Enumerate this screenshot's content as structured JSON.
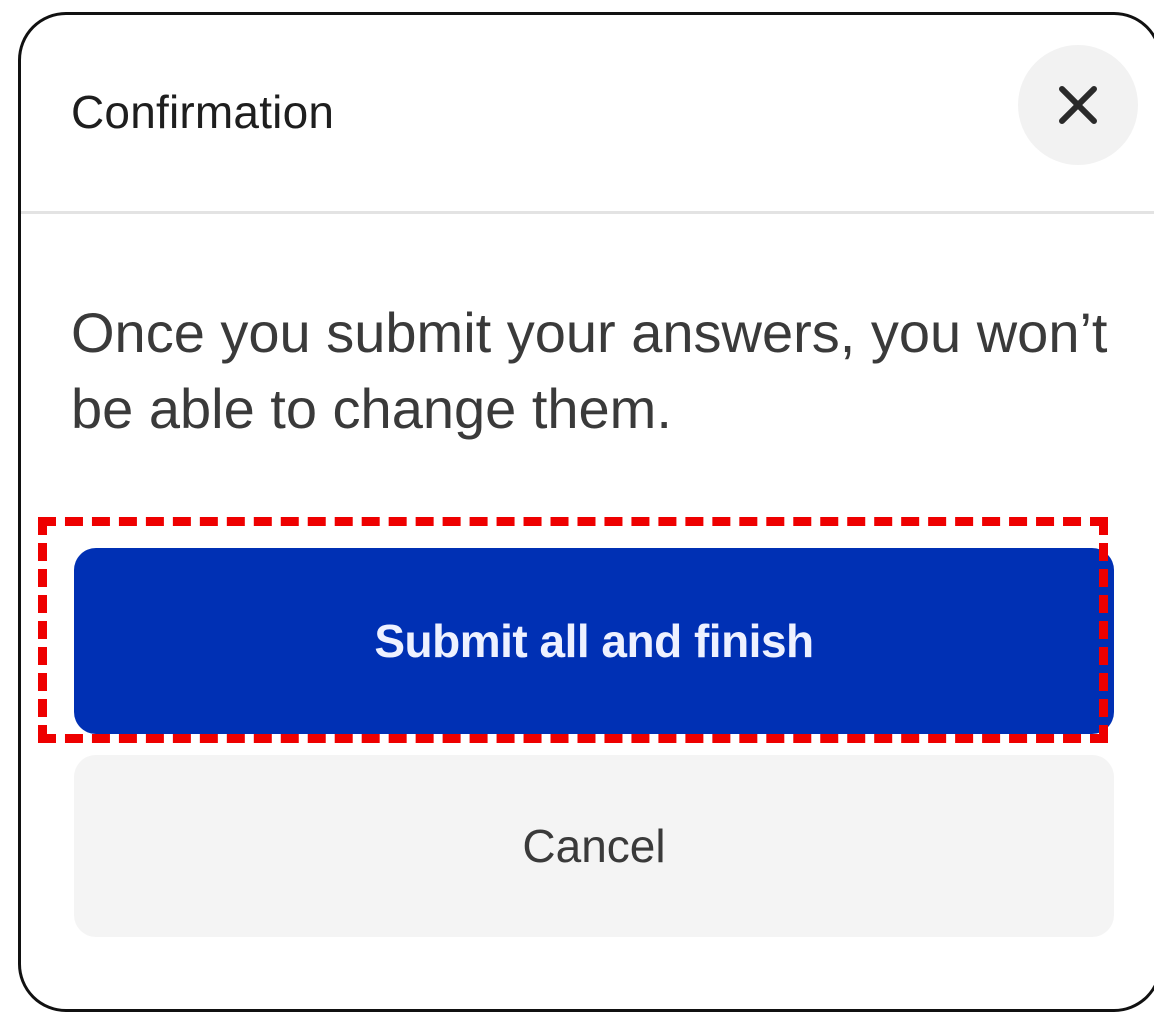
{
  "dialog": {
    "title": "Confirmation",
    "close_icon": "close-icon",
    "message": "Once you submit your answers, you won’t be able to change them.",
    "submit_label": "Submit all and finish",
    "cancel_label": "Cancel"
  },
  "colors": {
    "primary": "#0030b4",
    "highlight": "#ee0000",
    "secondary_bg": "#f4f4f4"
  }
}
